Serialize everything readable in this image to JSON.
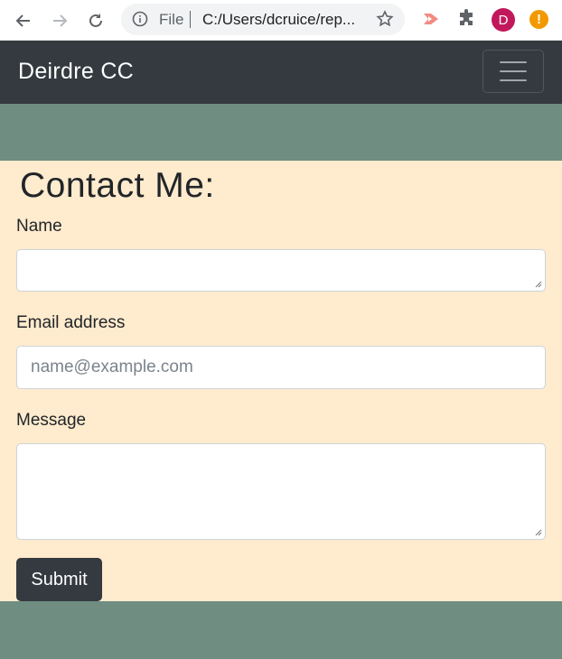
{
  "browser": {
    "url_scheme_label": "File",
    "url": "C:/Users/dcruice/rep...",
    "profile_initial": "D",
    "alert_symbol": "!",
    "colors": {
      "profile": "#c2185b",
      "alert": "#f29900"
    }
  },
  "navbar": {
    "brand": "Deirdre CC"
  },
  "contact": {
    "heading": "Contact Me:",
    "name_label": "Name",
    "name_value": "",
    "email_label": "Email address",
    "email_placeholder": "name@example.com",
    "message_label": "Message",
    "message_value": "",
    "submit_label": "Submit"
  },
  "colors": {
    "navbar": "#343a40",
    "band": "#708d81",
    "form_bg": "#ffebcd"
  }
}
